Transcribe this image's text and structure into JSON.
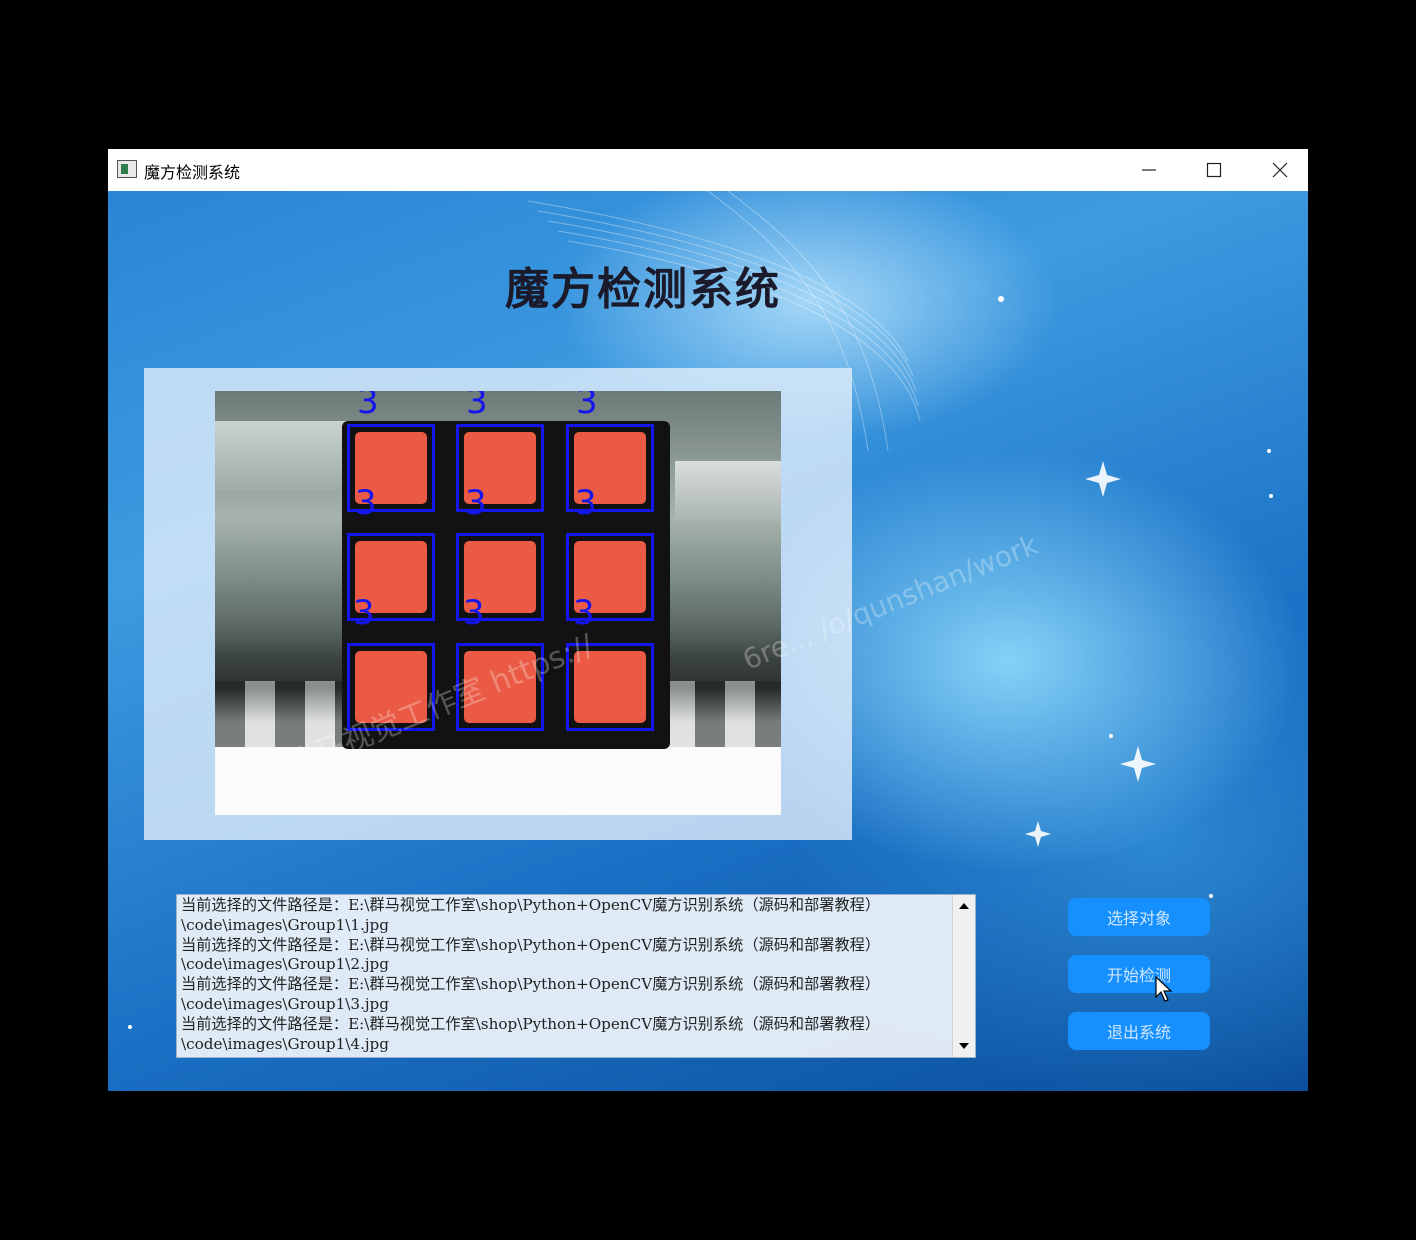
{
  "window": {
    "title": "魔方检测系统",
    "controls": [
      "minimize",
      "maximize",
      "close"
    ]
  },
  "main": {
    "title": "魔方检测系统"
  },
  "image_view": {
    "detected_marks": [
      "3",
      "3",
      "3",
      "3",
      "3",
      "3",
      "3",
      "3",
      "3"
    ],
    "watermark_1": "群马视觉工作室 https://",
    "watermark_2": "6re... /o/qunshan/work"
  },
  "log": {
    "lines": [
      "当前选择的文件路径是：E:\\群马视觉工作室\\shop\\Python+OpenCV魔方识别系统（源码和部署教程）",
      "\\code\\images\\Group1\\1.jpg",
      "当前选择的文件路径是：E:\\群马视觉工作室\\shop\\Python+OpenCV魔方识别系统（源码和部署教程）",
      "\\code\\images\\Group1\\2.jpg",
      "当前选择的文件路径是：E:\\群马视觉工作室\\shop\\Python+OpenCV魔方识别系统（源码和部署教程）",
      "\\code\\images\\Group1\\3.jpg",
      "当前选择的文件路径是：E:\\群马视觉工作室\\shop\\Python+OpenCV魔方识别系统（源码和部署教程）",
      "\\code\\images\\Group1\\4.jpg"
    ]
  },
  "buttons": {
    "select_object": "选择对象",
    "start_detect": "开始检测",
    "exit_system": "退出系统"
  },
  "colors": {
    "button_bg": "#1690ff",
    "detection_box": "#1515ee",
    "cube_face": "#ea5a44"
  }
}
